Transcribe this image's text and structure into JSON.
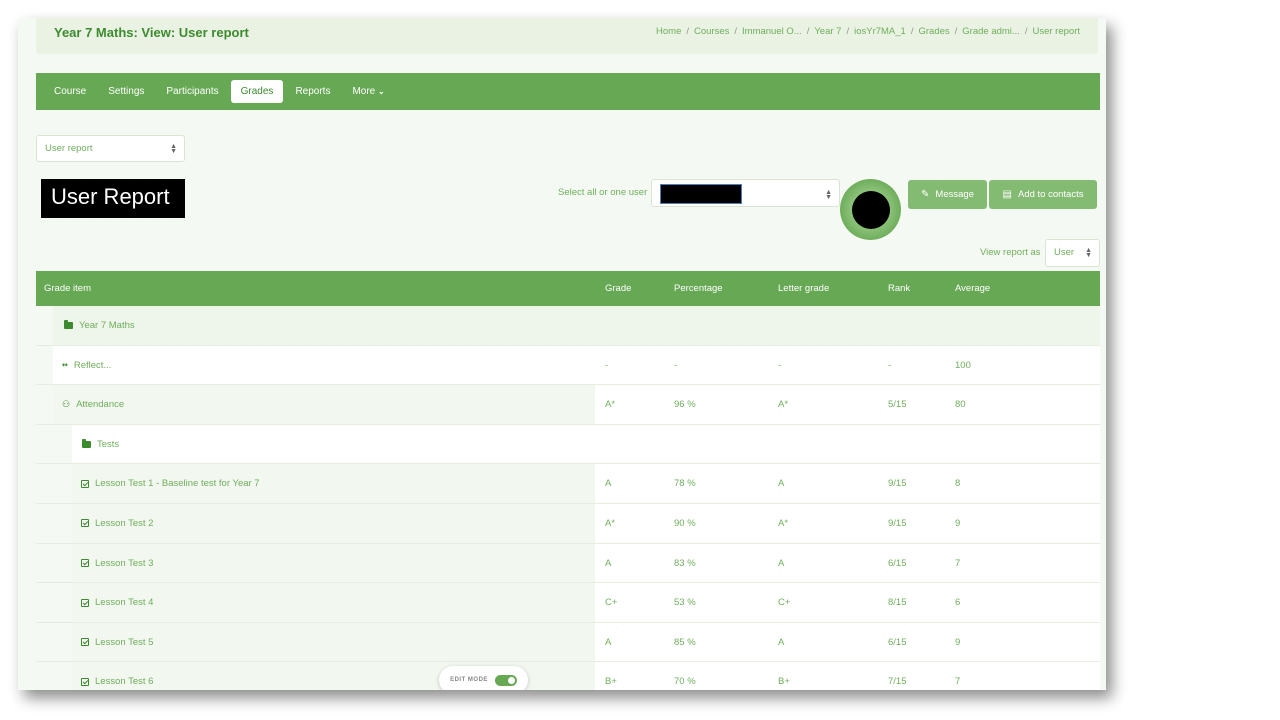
{
  "header": {
    "title": "Year 7 Maths: View: User report",
    "breadcrumb": [
      "Home",
      "Courses",
      "Immanuel O...",
      "Year 7",
      "iosYr7MA_1",
      "Grades",
      "Grade admi...",
      "User report"
    ]
  },
  "nav": {
    "items": [
      "Course",
      "Settings",
      "Participants",
      "Grades",
      "Reports",
      "More"
    ],
    "active": "Grades"
  },
  "report_select": {
    "value": "User report"
  },
  "page_heading": "User Report",
  "user_select": {
    "label": "Select all or one user"
  },
  "buttons": {
    "message": "Message",
    "add_contacts": "Add to contacts"
  },
  "view_as": {
    "label": "View report as",
    "value": "User"
  },
  "table": {
    "headers": [
      "Grade item",
      "Grade",
      "Percentage",
      "Letter grade",
      "Rank",
      "Average"
    ],
    "rows": [
      {
        "type": "category",
        "name": "Year 7 Maths",
        "grade": "",
        "percentage": "",
        "letter": "",
        "rank": "",
        "average": ""
      },
      {
        "type": "item",
        "icon": "reflect-icon",
        "name": "Reflect...",
        "grade": "-",
        "percentage": "-",
        "letter": "-",
        "rank": "-",
        "average": "100"
      },
      {
        "type": "item",
        "icon": "attendance-icon",
        "name": "Attendance",
        "grade": "A*",
        "percentage": "96 %",
        "letter": "A*",
        "rank": "5/15",
        "average": "80"
      },
      {
        "type": "category",
        "name": "Tests",
        "grade": "",
        "percentage": "",
        "letter": "",
        "rank": "",
        "average": ""
      },
      {
        "type": "quiz",
        "icon": "quiz-icon",
        "name": "Lesson Test 1 - Baseline test for Year 7",
        "grade": "A",
        "percentage": "78 %",
        "letter": "A",
        "rank": "9/15",
        "average": "8"
      },
      {
        "type": "quiz",
        "icon": "quiz-icon",
        "name": "Lesson Test 2",
        "grade": "A*",
        "percentage": "90 %",
        "letter": "A*",
        "rank": "9/15",
        "average": "9"
      },
      {
        "type": "quiz",
        "icon": "quiz-icon",
        "name": "Lesson Test 3",
        "grade": "A",
        "percentage": "83 %",
        "letter": "A",
        "rank": "6/15",
        "average": "7"
      },
      {
        "type": "quiz",
        "icon": "quiz-icon",
        "name": "Lesson Test 4",
        "grade": "C+",
        "percentage": "53 %",
        "letter": "C+",
        "rank": "8/15",
        "average": "6"
      },
      {
        "type": "quiz",
        "icon": "quiz-icon",
        "name": "Lesson Test 5",
        "grade": "A",
        "percentage": "85 %",
        "letter": "A",
        "rank": "6/15",
        "average": "9"
      },
      {
        "type": "quiz",
        "icon": "quiz-icon",
        "name": "Lesson Test 6",
        "grade": "B+",
        "percentage": "70 %",
        "letter": "B+",
        "rank": "7/15",
        "average": "7"
      }
    ]
  },
  "edit_mode": {
    "label": "EDIT MODE",
    "on": true
  },
  "colors": {
    "accent": "#67a854",
    "text_green": "#6fae5c",
    "dark_green": "#3d8b2f"
  }
}
